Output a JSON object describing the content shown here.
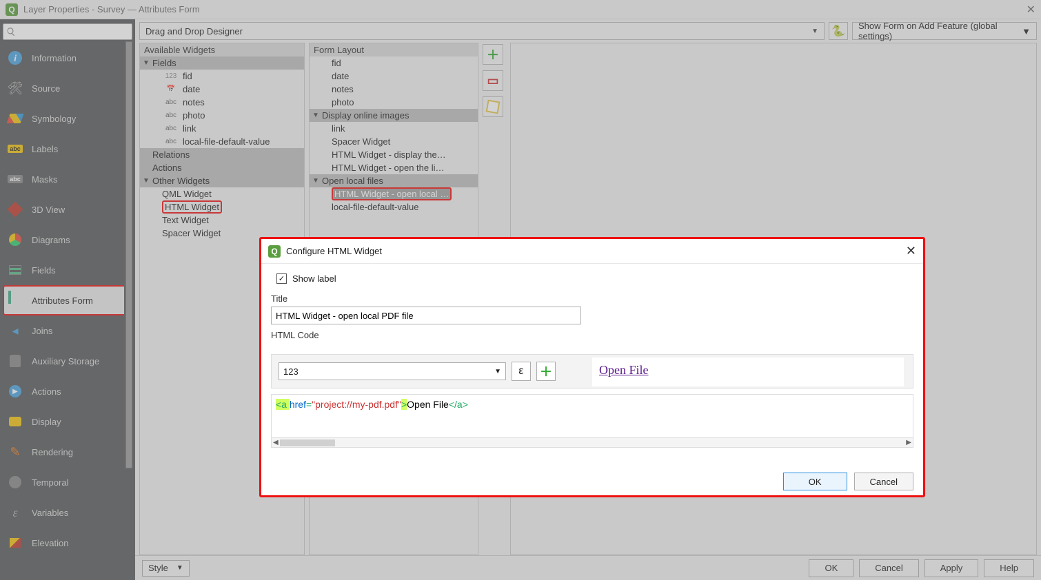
{
  "window": {
    "title": "Layer Properties - Survey — Attributes Form",
    "q_letter": "Q"
  },
  "sidebar": {
    "items": [
      {
        "label": "Information"
      },
      {
        "label": "Source"
      },
      {
        "label": "Symbology"
      },
      {
        "label": "Labels"
      },
      {
        "label": "Masks"
      },
      {
        "label": "3D View"
      },
      {
        "label": "Diagrams"
      },
      {
        "label": "Fields"
      },
      {
        "label": "Attributes Form"
      },
      {
        "label": "Joins"
      },
      {
        "label": "Auxiliary Storage"
      },
      {
        "label": "Actions"
      },
      {
        "label": "Display"
      },
      {
        "label": "Rendering"
      },
      {
        "label": "Temporal"
      },
      {
        "label": "Variables"
      },
      {
        "label": "Elevation"
      }
    ]
  },
  "toolbar": {
    "designer_mode": "Drag and Drop Designer",
    "show_form": "Show Form on Add Feature (global settings)"
  },
  "available": {
    "header": "Available Widgets",
    "groups": {
      "fields": "Fields",
      "relations": "Relations",
      "actions": "Actions",
      "other": "Other Widgets"
    },
    "fields": [
      {
        "badge": "123",
        "label": "fid"
      },
      {
        "badge": "📅",
        "label": "date"
      },
      {
        "badge": "abc",
        "label": "notes"
      },
      {
        "badge": "abc",
        "label": "photo"
      },
      {
        "badge": "abc",
        "label": "link"
      },
      {
        "badge": "abc",
        "label": "local-file-default-value"
      }
    ],
    "other": [
      {
        "label": "QML Widget"
      },
      {
        "label": "HTML Widget"
      },
      {
        "label": "Text Widget"
      },
      {
        "label": "Spacer Widget"
      }
    ]
  },
  "layout": {
    "header": "Form Layout",
    "root": [
      "fid",
      "date",
      "notes",
      "photo"
    ],
    "group1": {
      "name": "Display online images",
      "items": [
        "link",
        "Spacer Widget",
        "HTML Widget - display the…",
        "HTML Widget - open the li…"
      ]
    },
    "group2": {
      "name": "Open local files",
      "items": [
        "HTML Widget - open local …",
        "local-file-default-value"
      ]
    }
  },
  "dialog": {
    "title": "Configure HTML Widget",
    "show_label": "Show label",
    "title_label": "Title",
    "title_value": "HTML Widget - open local PDF file",
    "code_label": "HTML Code",
    "expr_value": "123",
    "epsilon": "ε",
    "code_parts": {
      "t1": "<a ",
      "attr": "href",
      "eq": "=",
      "str": "\"project://my-pdf.pdf\"",
      "gt": ">",
      "text": "Open File",
      "close": "</a>"
    },
    "preview_text": "Open File",
    "ok": "OK",
    "cancel": "Cancel"
  },
  "bottom": {
    "style": "Style",
    "ok": "OK",
    "cancel": "Cancel",
    "apply": "Apply",
    "help": "Help"
  }
}
